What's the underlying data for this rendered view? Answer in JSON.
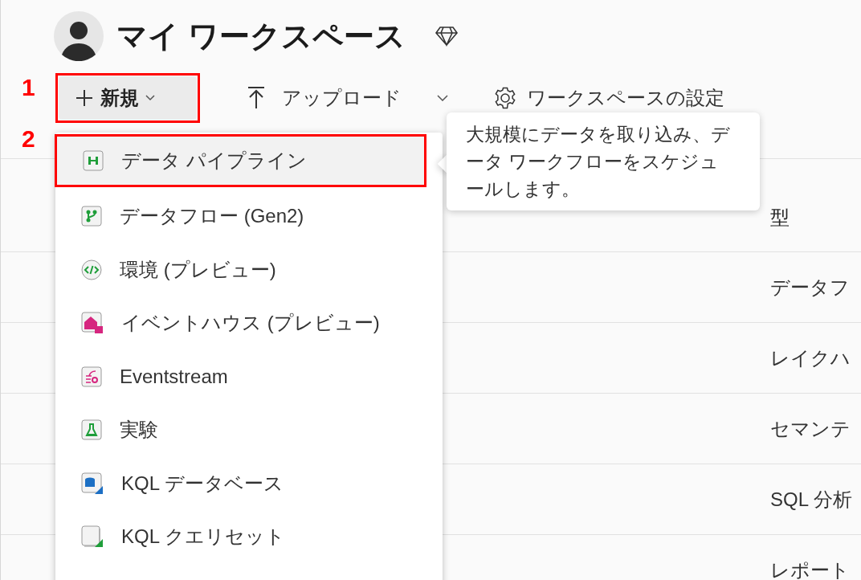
{
  "workspace": {
    "title": "マイ ワークスペース"
  },
  "annotations": [
    "1",
    "2"
  ],
  "toolbar": {
    "new_button": {
      "label": "新規"
    },
    "upload_button": {
      "label": "アップロード"
    },
    "settings_button": {
      "label": "ワークスペースの設定"
    }
  },
  "new_menu": {
    "items": [
      {
        "kind": "pipeline",
        "label": "データ パイプライン",
        "selected": true
      },
      {
        "kind": "dataflow",
        "label": "データフロー (Gen2)",
        "selected": false
      },
      {
        "kind": "environment",
        "label": "環境 (プレビュー)",
        "selected": false
      },
      {
        "kind": "eventhouse",
        "label": "イベントハウス (プレビュー)",
        "selected": false
      },
      {
        "kind": "eventstream",
        "label": "Eventstream",
        "selected": false
      },
      {
        "kind": "experiment",
        "label": "実験",
        "selected": false
      },
      {
        "kind": "kql-database",
        "label": "KQL データベース",
        "selected": false
      },
      {
        "kind": "kql-queryset",
        "label": "KQL クエリセット",
        "selected": false
      }
    ]
  },
  "tooltip": {
    "text": "大規模にデータを取り込み、データ ワークフローをスケジュールします。"
  },
  "table": {
    "columns": [
      "型"
    ],
    "rows": [
      [
        "データフ"
      ],
      [
        "レイクハ"
      ],
      [
        "セマンテ"
      ],
      [
        "SQL 分析"
      ],
      [
        "レポート"
      ]
    ]
  }
}
